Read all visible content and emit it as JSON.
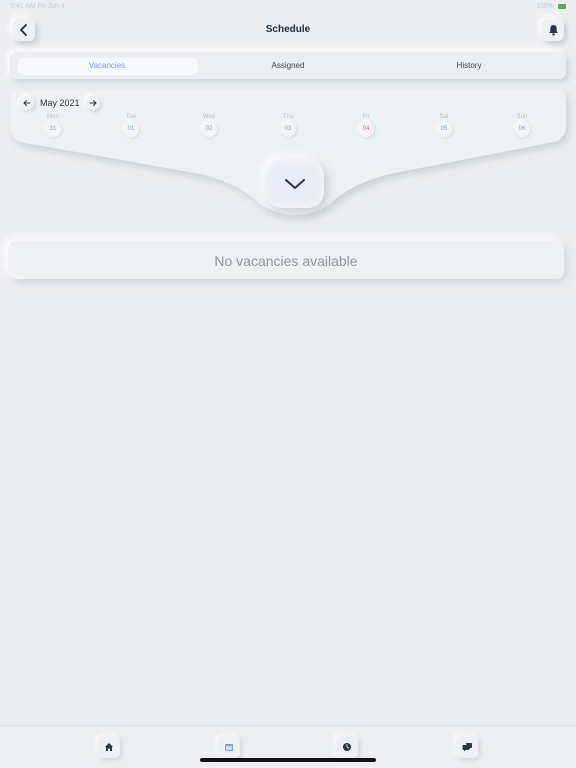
{
  "status_bar": {
    "time": "9:41 AM  Fri Jun 4",
    "indicators": "100%"
  },
  "header": {
    "title": "Schedule",
    "back_icon": "chevron-left-icon",
    "notification_icon": "bell-icon"
  },
  "tabs": [
    {
      "label": "Vacancies",
      "active": true
    },
    {
      "label": "Assigned",
      "active": false
    },
    {
      "label": "History",
      "active": false
    }
  ],
  "calendar": {
    "month": "May 2021",
    "days": [
      {
        "name": "Mon",
        "num": "31",
        "today": false
      },
      {
        "name": "Tue",
        "num": "01",
        "today": false
      },
      {
        "name": "Wed",
        "num": "02",
        "today": false
      },
      {
        "name": "Thu",
        "num": "03",
        "today": false
      },
      {
        "name": "Fri",
        "num": "04",
        "today": true
      },
      {
        "name": "Sat",
        "num": "05",
        "today": false
      },
      {
        "name": "Sun",
        "num": "06",
        "today": false
      }
    ],
    "expand_icon": "chevron-down-icon"
  },
  "empty_state": {
    "text": "No vacancies available"
  },
  "bottom_nav": [
    {
      "name": "home",
      "icon": "home-icon",
      "active": false
    },
    {
      "name": "schedule",
      "icon": "calendar-icon",
      "active": true
    },
    {
      "name": "history",
      "icon": "clock-icon",
      "active": false
    },
    {
      "name": "chat",
      "icon": "chat-icon",
      "active": false
    }
  ],
  "colors": {
    "accent": "#7a9ee6",
    "today": "#e06a6a",
    "background": "#ecedf2"
  }
}
